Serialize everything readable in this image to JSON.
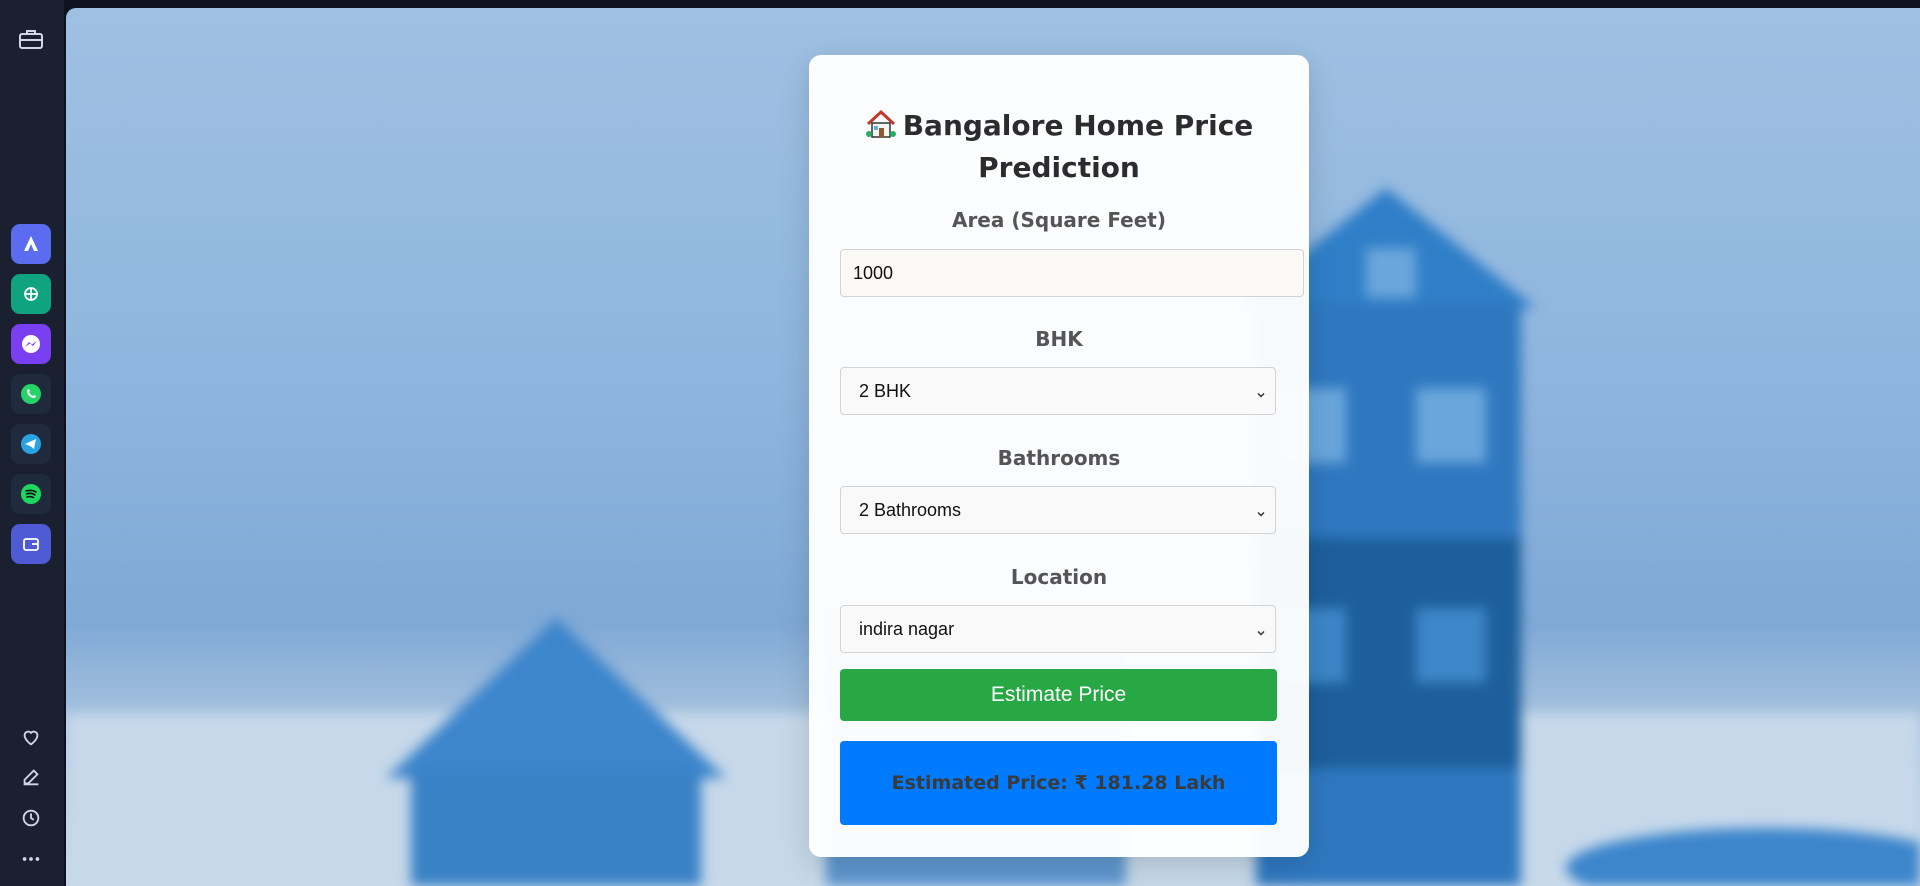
{
  "rail": {
    "top_icon": "briefcase-icon",
    "apps": [
      {
        "name": "arc-app-icon",
        "color": "#5b6cf0"
      },
      {
        "name": "chatgpt-app-icon",
        "color": "#10a37f"
      },
      {
        "name": "messenger-app-icon",
        "color": "#a033ff"
      },
      {
        "name": "whatsapp-app-icon",
        "color": "#25d366"
      },
      {
        "name": "telegram-app-icon",
        "color": "#2aa3e0"
      },
      {
        "name": "spotify-app-icon",
        "color": "#1ed760"
      },
      {
        "name": "wallet-app-icon",
        "color": "#4f5bd5"
      }
    ],
    "bottom_icons": [
      "heart-icon",
      "edit-icon",
      "history-icon",
      "more-icon"
    ]
  },
  "card": {
    "title_icon": "house-icon",
    "title": "Bangalore Home Price Prediction",
    "area": {
      "label": "Area (Square Feet)",
      "value": "1000"
    },
    "bhk": {
      "label": "BHK",
      "selected": "2 BHK"
    },
    "bathrooms": {
      "label": "Bathrooms",
      "selected": "2 Bathrooms"
    },
    "location": {
      "label": "Location",
      "selected": "indira nagar"
    },
    "estimate_button": "Estimate Price",
    "result": "Estimated Price: ₹ 181.28 Lakh"
  },
  "colors": {
    "estimate_button": "#28a745",
    "result_box": "#007bff",
    "rail": "#1b2030"
  }
}
